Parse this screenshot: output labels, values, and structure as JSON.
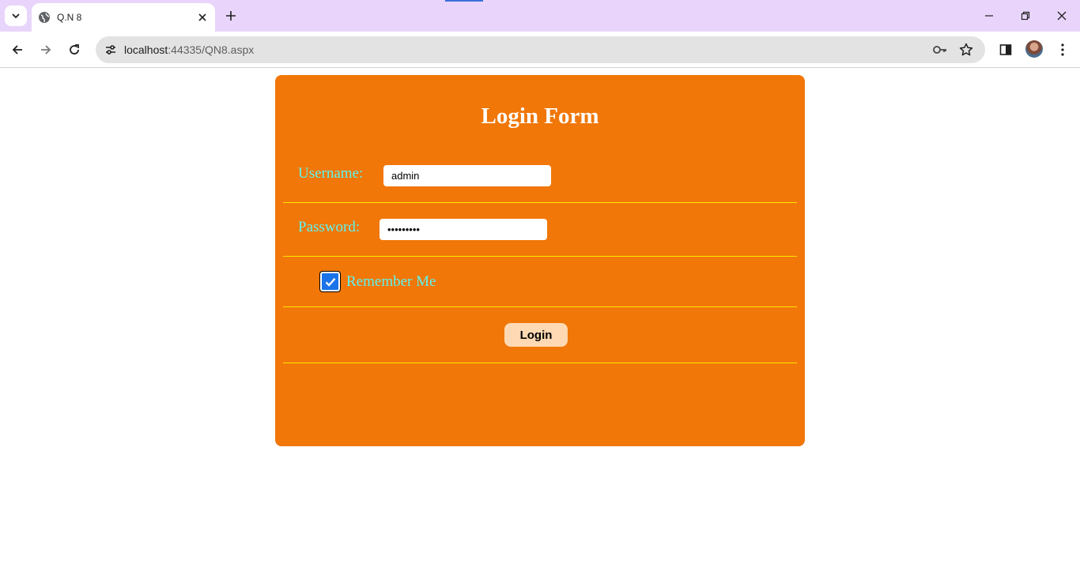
{
  "browser": {
    "tab_title": "Q.N 8",
    "url_host": "localhost",
    "url_path": ":44335/QN8.aspx"
  },
  "icons": {
    "tab_search": "chevron-down-icon",
    "favicon": "globe-icon",
    "tab_close": "close-icon",
    "new_tab": "plus-icon",
    "back": "back-arrow-icon",
    "forward": "forward-arrow-icon",
    "reload": "reload-icon",
    "site_info": "tune-icon",
    "password_key": "key-icon",
    "bookmark": "star-icon",
    "side_panel": "side-panel-icon",
    "menu": "kebab-menu-icon"
  },
  "form": {
    "title": "Login Form",
    "username_label": "Username:",
    "username_value": "admin",
    "password_label": "Password:",
    "password_value": "•••••••••",
    "remember_label": "Remember Me",
    "remember_checked": true,
    "login_label": "Login"
  },
  "colors": {
    "card_bg": "#f07708",
    "label_text": "#5ff5ee",
    "divider": "#ffe600",
    "button_bg": "#ffd9b3",
    "checkbox_fill": "#1a73e8",
    "tabstrip_bg": "#e9d5fb"
  }
}
